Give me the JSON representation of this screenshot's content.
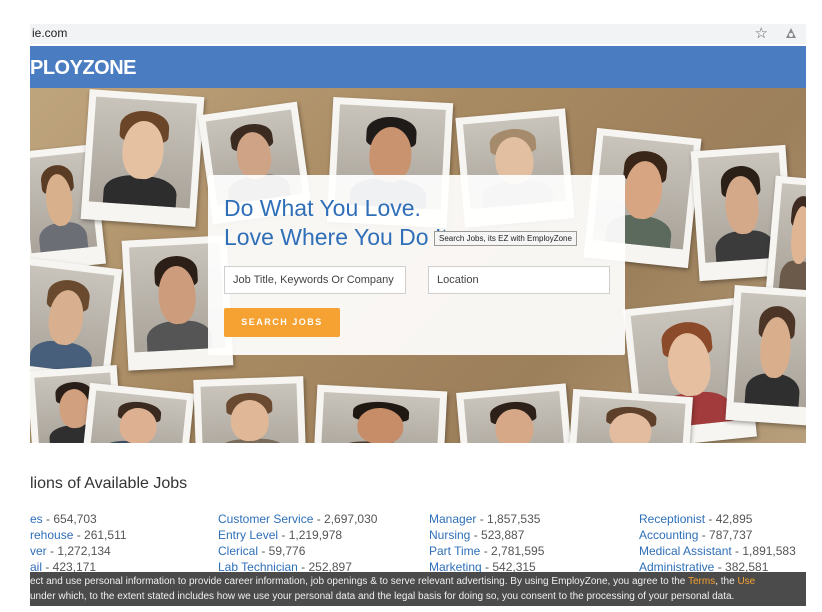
{
  "browser": {
    "url": "ie.com"
  },
  "header": {
    "logo_text": "PLOYZONE"
  },
  "hero": {
    "headline_line1": "Do What You Love.",
    "headline_line2": "Love Where You Do It.",
    "tooltip": "Search Jobs, its EZ with EmployZone",
    "job_placeholder": "Job Title, Keywords Or Company",
    "location_placeholder": "Location",
    "search_button": "SEARCH JOBS"
  },
  "section": {
    "title": "lions of Available Jobs"
  },
  "jobs": {
    "col1": [
      {
        "cat": "es",
        "count": " - 654,703"
      },
      {
        "cat": "rehouse",
        "count": " - 261,511"
      },
      {
        "cat": "ver",
        "count": " - 1,272,134"
      },
      {
        "cat": "ail",
        "count": " - 423,171"
      }
    ],
    "col2": [
      {
        "cat": "Customer Service",
        "count": " - 2,697,030"
      },
      {
        "cat": "Entry Level",
        "count": " - 1,219,978"
      },
      {
        "cat": "Clerical",
        "count": " - 59,776"
      },
      {
        "cat": "Lab Technician",
        "count": " - 252,897"
      }
    ],
    "col3": [
      {
        "cat": "Manager",
        "count": " - 1,857,535"
      },
      {
        "cat": "Nursing",
        "count": " - 523,887"
      },
      {
        "cat": "Part Time",
        "count": " - 2,781,595"
      },
      {
        "cat": "Marketing",
        "count": " - 542,315"
      }
    ],
    "col4": [
      {
        "cat": "Receptionist",
        "count": " - 42,895"
      },
      {
        "cat": "Accounting",
        "count": " - 787,737"
      },
      {
        "cat": "Medical Assistant",
        "count": " - 1,891,583"
      },
      {
        "cat": "Administrative",
        "count": " - 382,581"
      }
    ]
  },
  "cookie": {
    "line1_text": "ect and use personal information to provide career information, job openings & to serve relevant advertising. By using EmployZone, you agree to the ",
    "terms_link": "Terms",
    "line1_mid": ", the ",
    "use_link": "Use",
    "line2_text": " under which, to the extent stated includes how we use your personal data and the legal basis for doing so, you consent to the processing of your personal data."
  },
  "colors": {
    "header_blue": "#4a7cc1",
    "headline_blue": "#2f6fb8",
    "accent_orange": "#f5a233",
    "link_blue": "#2f6fb8"
  }
}
